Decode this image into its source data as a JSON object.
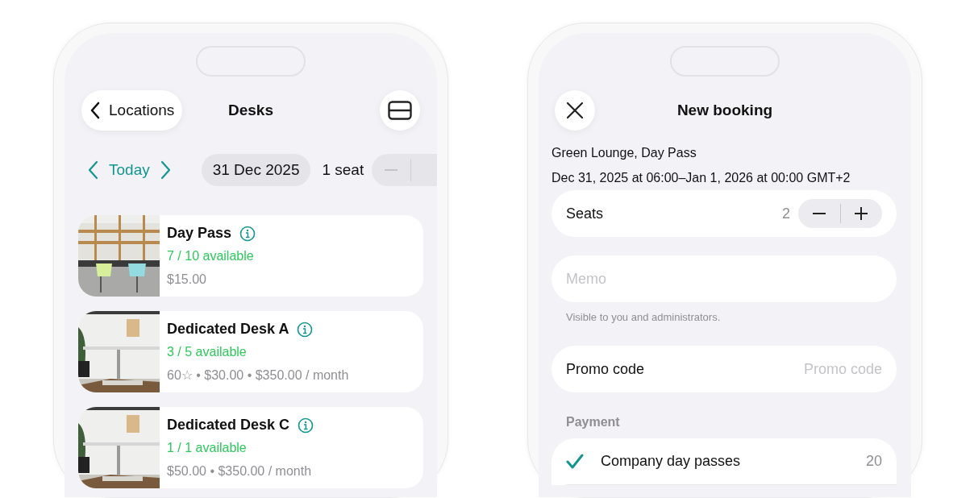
{
  "desks_screen": {
    "back_label": "Locations",
    "title": "Desks",
    "date_bar": {
      "today": "Today",
      "date": "31 Dec 2025",
      "seats": "1 seat"
    },
    "items": [
      {
        "title": "Day Pass",
        "availability": "7 / 10 available",
        "price": "$15.00"
      },
      {
        "title": "Dedicated Desk A",
        "availability": "3 / 5 available",
        "price": "60☆ • $30.00 • $350.00 / month"
      },
      {
        "title": "Dedicated Desk C",
        "availability": "1 / 1 available",
        "price": "$50.00 • $350.00 / month"
      }
    ]
  },
  "booking_screen": {
    "title": "New booking",
    "location": "Green Lounge, Day Pass",
    "time_range": "Dec 31, 2025 at 06:00–Jan 1, 2026 at 00:00 GMT+2",
    "seats": {
      "label": "Seats",
      "value": "2"
    },
    "memo": {
      "placeholder": "Memo",
      "hint": "Visible to you and administrators."
    },
    "promo": {
      "label": "Promo code",
      "placeholder": "Promo code"
    },
    "payment": {
      "header": "Payment",
      "options": [
        {
          "label": "Company day passes",
          "count": "20",
          "selected": true
        }
      ]
    }
  }
}
